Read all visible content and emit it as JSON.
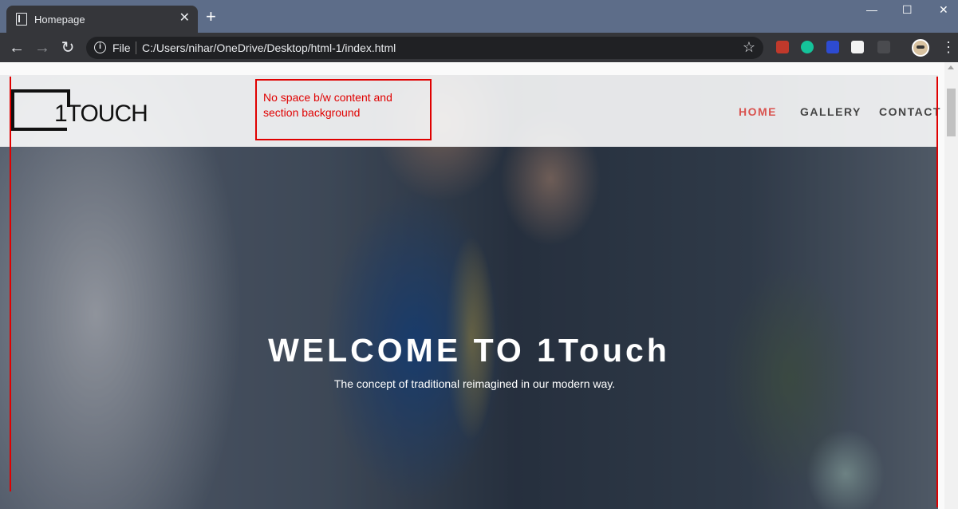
{
  "browser": {
    "tab_title": "Homepage",
    "new_tab_label": "+",
    "url_scheme_label": "File",
    "url": "C:/Users/nihar/OneDrive/Desktop/html-1/index.html",
    "icons": [
      "back-icon",
      "forward-icon",
      "reload-icon",
      "info-icon",
      "star-icon",
      "menu-icon"
    ],
    "window_controls": {
      "minimize": "—",
      "maximize": "☐",
      "close": "✕"
    }
  },
  "site": {
    "logo_text": "1TOUCH",
    "nav": [
      "HOME",
      "GALLERY",
      "CONTACT"
    ],
    "active_nav": "HOME",
    "accent_color": "#d9534f",
    "hero_title": "WELCOME TO 1Touch",
    "hero_subtitle": "The concept of traditional reimagined in our modern way."
  },
  "annotation": {
    "text": "No space b/w content and section background",
    "color": "#e00000"
  }
}
